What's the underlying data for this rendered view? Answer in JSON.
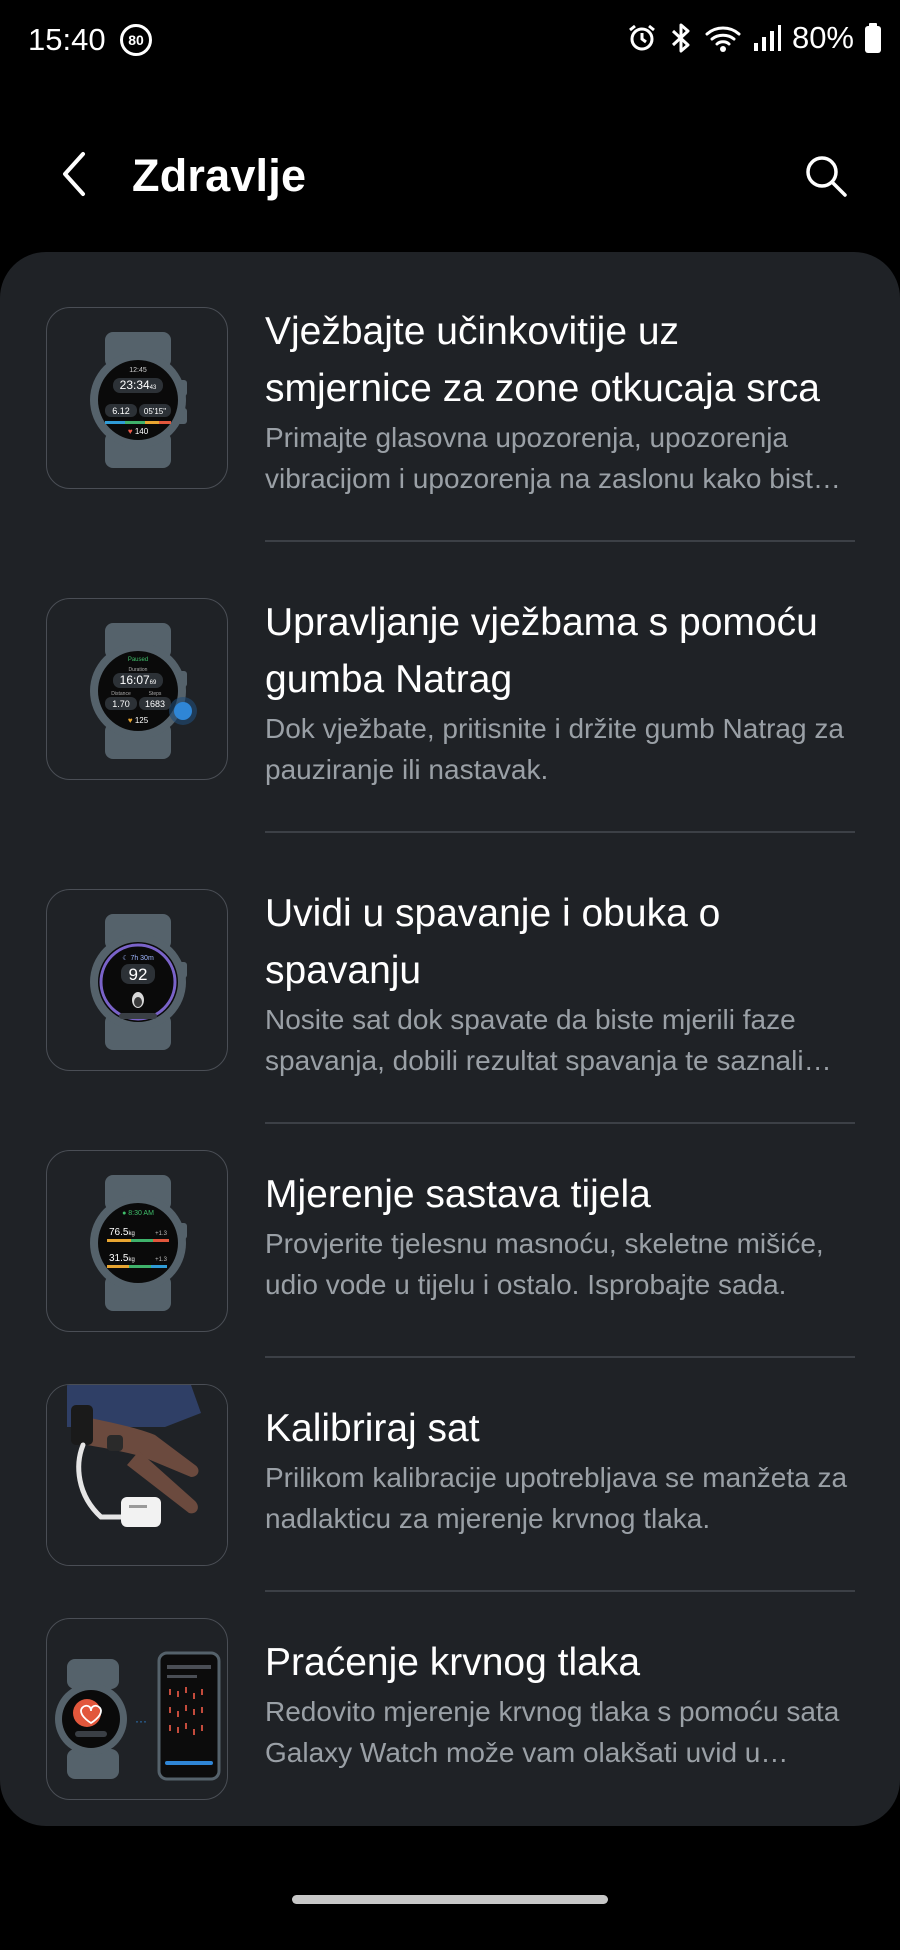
{
  "status_bar": {
    "time": "15:40",
    "badge": "80",
    "battery": "80%",
    "icons": [
      "alarm-icon",
      "bluetooth-icon",
      "wifi-icon",
      "signal-icon",
      "battery-icon"
    ]
  },
  "header": {
    "title": "Zdravlje",
    "back_icon": "back-arrow-icon",
    "search_icon": "search-icon"
  },
  "items": [
    {
      "title": "Vježbajte učinkovitije uz smjernice za zone otkucaja srca",
      "description": "Primajte glasovna upozorenja, upozorenja vibracijom i upozorenja na zaslonu kako biste ostali u željenoj zoni.",
      "thumb": {
        "top": "12:45",
        "big": "23:34",
        "sup": "43",
        "left": "6.12",
        "right": "05'15\"",
        "heart": "140"
      }
    },
    {
      "title": "Upravljanje vježbama s pomoću gumba Natrag",
      "description": "Dok vježbate, pritisnite i držite gumb Natrag za pauziranje ili nastavak.",
      "thumb": {
        "top": "Paused",
        "label": "Duration",
        "big": "16:07",
        "sup": "69",
        "left_label": "Distance",
        "right_label": "Steps",
        "left": "1.70",
        "right": "1683",
        "heart": "125"
      }
    },
    {
      "title": "Uvidi u spavanje i obuka o spavanju",
      "description": "Nosite sat dok spavate da biste mjerili faze spavanja, dobili rezultat spavanja te saznali više.",
      "thumb": {
        "top": "7h 30m",
        "big": "92"
      }
    },
    {
      "title": "Mjerenje sastava tijela",
      "description": "Provjerite tjelesnu masnoću, skeletne mišiće, udio vode u tijelu i ostalo. Isprobajte sada.",
      "thumb": {
        "top": "8:30 AM",
        "first": "76.5",
        "first_unit": "kg",
        "first_delta": "+1.3",
        "second": "31.5",
        "second_unit": "kg",
        "second_delta": "+1.3"
      }
    },
    {
      "title": "Kalibriraj sat",
      "description": "Prilikom kalibracije upotrebljava se manžeta za nadlakticu za mjerenje krvnog tlaka.",
      "thumb": {}
    },
    {
      "title": "Praćenje krvnog tlaka",
      "description": "Redovito mjerenje krvnog tlaka s pomoću sata Galaxy Watch može vam olakšati uvid u zdravlje.",
      "thumb": {}
    }
  ],
  "colors": {
    "background": "#000000",
    "card": "#1f2226",
    "divider": "#3c4046",
    "secondary_text": "#9aa0a6",
    "watch_body": "#55626b"
  }
}
